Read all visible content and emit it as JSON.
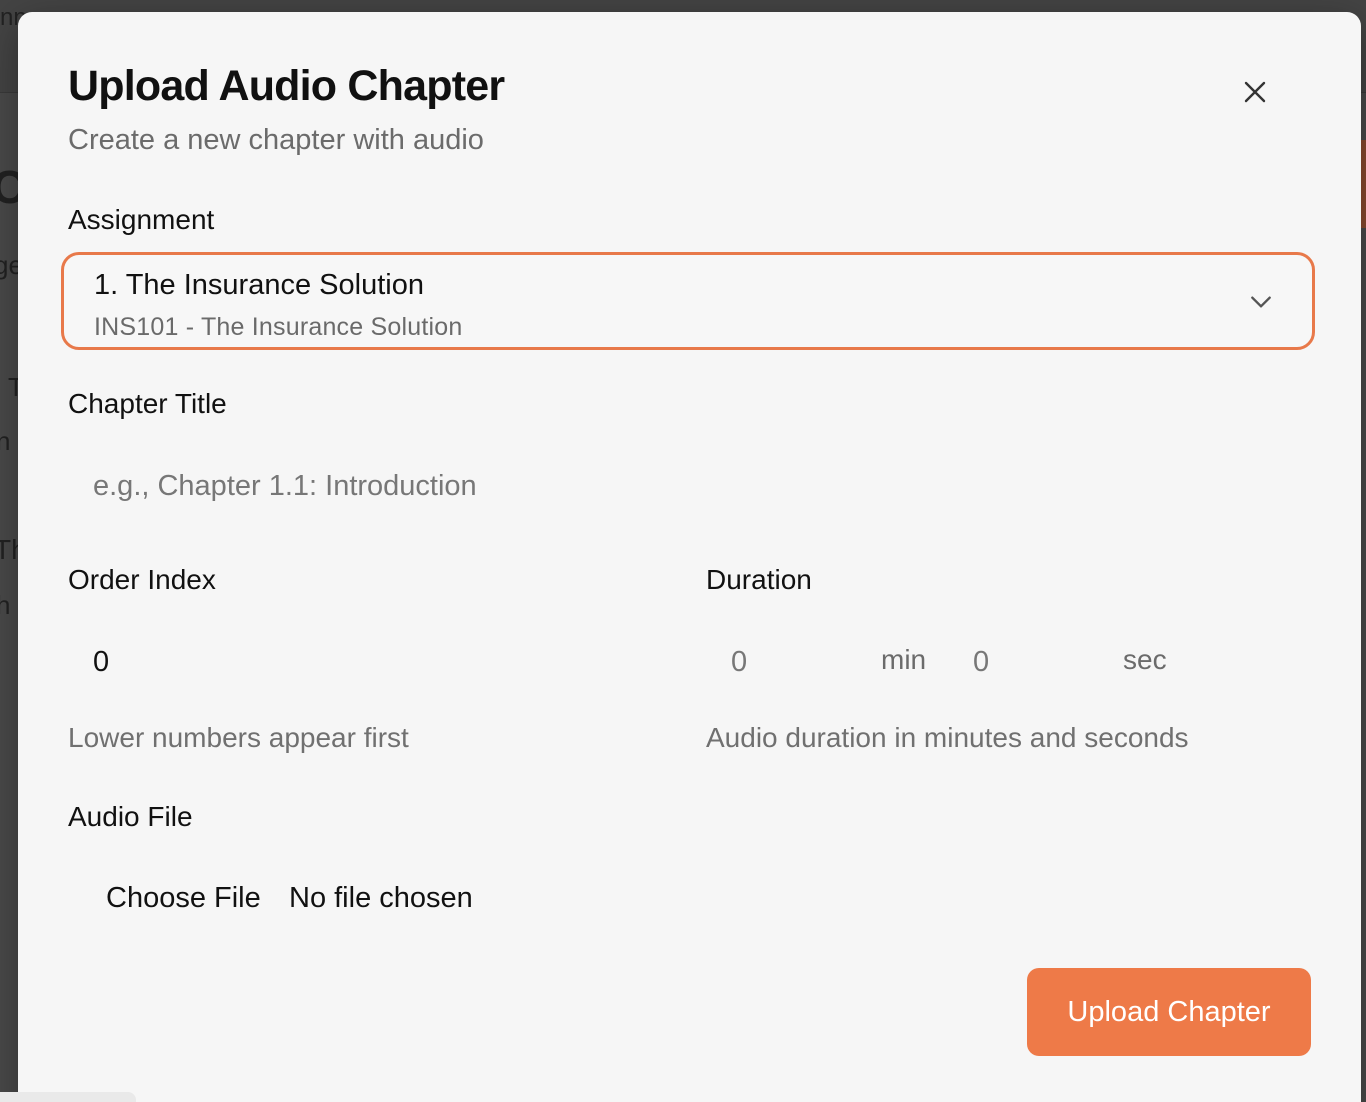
{
  "background": {
    "fragments": [
      "nn",
      "Co",
      "ge",
      "T",
      "n",
      "Th",
      "h"
    ]
  },
  "modal": {
    "title": "Upload Audio Chapter",
    "subtitle": "Create a new chapter with audio",
    "close_icon": "close-icon",
    "assignment": {
      "label": "Assignment",
      "selected_title": "1. The Insurance Solution",
      "selected_subtitle": "INS101 - The Insurance Solution"
    },
    "chapter_title": {
      "label": "Chapter Title",
      "value": "",
      "placeholder": "e.g., Chapter 1.1: Introduction"
    },
    "order_index": {
      "label": "Order Index",
      "value": "0",
      "hint": "Lower numbers appear first"
    },
    "duration": {
      "label": "Duration",
      "minutes_placeholder": "0",
      "minutes_unit": "min",
      "seconds_placeholder": "0",
      "seconds_unit": "sec",
      "hint": "Audio duration in minutes and seconds"
    },
    "audio_file": {
      "label": "Audio File",
      "button_label": "Choose File",
      "status": "No file chosen"
    },
    "submit_label": "Upload Chapter",
    "accent_color": "#ee7a48"
  }
}
